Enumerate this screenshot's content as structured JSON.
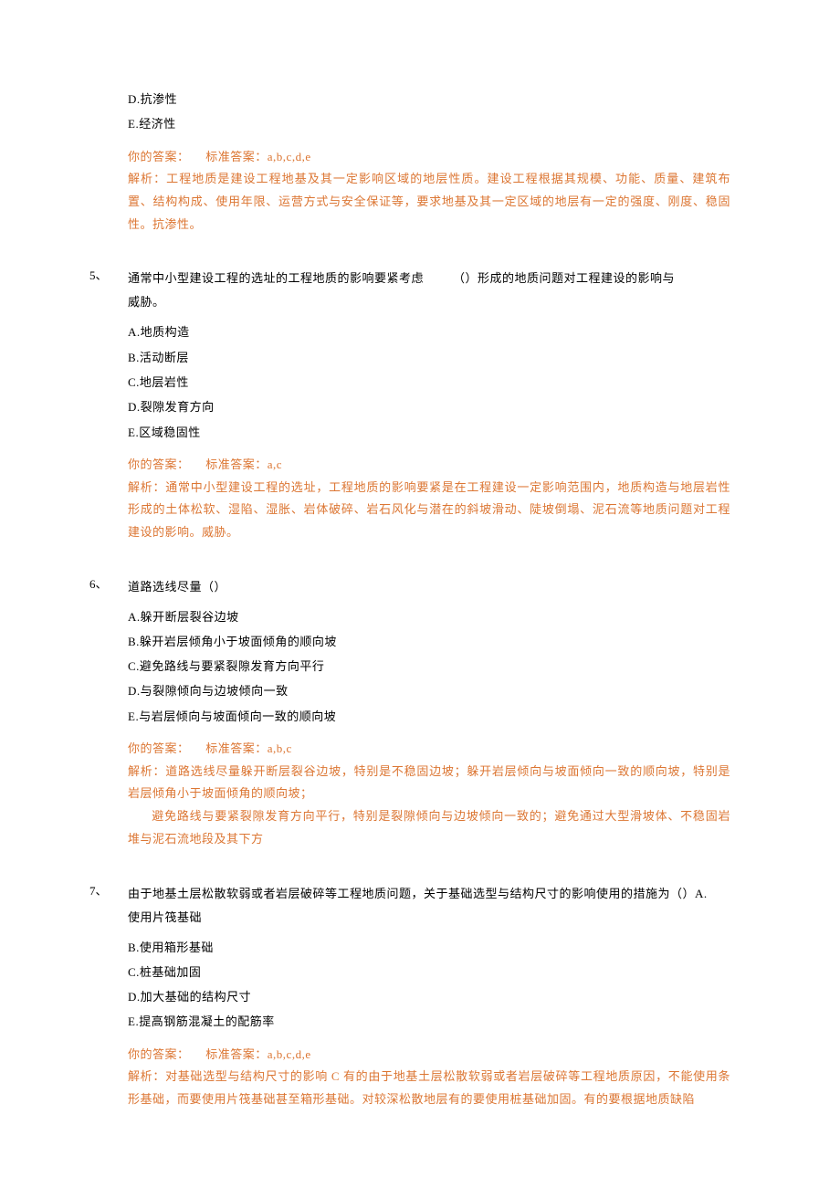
{
  "top": {
    "opt_d": "D.抗渗性",
    "opt_e": "E.经济性",
    "your_answer_label": "你的答案：",
    "std_answer_label": "标准答案：",
    "std_answer_value": "a,b,c,d,e",
    "expl_label": "解析：",
    "expl_text": "工程地质是建设工程地基及其一定影响区域的地层性质。建设工程根据其规模、功能、质量、建筑布置、结构构成、使用年限、运营方式与安全保证等，要求地基及其一定区域的地层有一定的强度、刚度、稳固性。抗渗性。"
  },
  "q5": {
    "num": "5、",
    "stem_a": "通常中小型建设工程的选址的工程地质的影响要紧考虑",
    "stem_b": "（）形成的地质问题对工程建设的影响与",
    "stem_c": "威胁。",
    "opt_a": "A.地质构造",
    "opt_b": "B.活动断层",
    "opt_c": "C.地层岩性",
    "opt_d": "D.裂隙发育方向",
    "opt_e": "E.区域稳固性",
    "your_answer_label": "你的答案：",
    "std_answer_label": "标准答案：",
    "std_answer_value": "a,c",
    "expl_label": "解析：",
    "expl_text": "通常中小型建设工程的选址，工程地质的影响要紧是在工程建设一定影响范围内，地质构造与地层岩性形成的土体松软、湿陷、湿胀、岩体破碎、岩石风化与潜在的斜坡滑动、陡坡倒塌、泥石流等地质问题对工程建设的影响。威胁。"
  },
  "q6": {
    "num": "6、",
    "stem": "道路选线尽量（）",
    "opt_a": "A.躲开断层裂谷边坡",
    "opt_b": "B.躲开岩层倾角小于坡面倾角的顺向坡",
    "opt_c": "C.避免路线与要紧裂隙发育方向平行",
    "opt_d": "D.与裂隙倾向与边坡倾向一致",
    "opt_e": "E.与岩层倾向与坡面倾向一致的顺向坡",
    "your_answer_label": "你的答案：",
    "std_answer_label": "标准答案：",
    "std_answer_value": "a,b,c",
    "expl_label": "解析：",
    "expl_text1": "道路选线尽量躲开断层裂谷边坡，特别是不稳固边坡；躲开岩层倾向与坡面倾向一致的顺向坡，特别是岩层倾角小于坡面倾角的顺向坡；",
    "expl_text2": "避免路线与要紧裂隙发育方向平行，特别是裂隙倾向与边坡倾向一致的；避免通过大型滑坡体、不稳固岩堆与泥石流地段及其下方"
  },
  "q7": {
    "num": "7、",
    "stem_a": "由于地基土层松散软弱或者岩层破碎等工程地质问题，关于基础选型与结构尺寸的影响使用的措施为（）A.",
    "stem_b": "使用片筏基础",
    "opt_b": "B.使用箱形基础",
    "opt_c": "C.桩基础加固",
    "opt_d": "D.加大基础的结构尺寸",
    "opt_e": "E.提高钢筋混凝土的配筋率",
    "your_answer_label": "你的答案：",
    "std_answer_label": "标准答案：",
    "std_answer_value": "a,b,c,d,e",
    "expl_label": "解析：",
    "expl_text": "对基础选型与结构尺寸的影响 C 有的由于地基土层松散软弱或者岩层破碎等工程地质原因，不能使用条形基础，而要使用片筏基础甚至箱形基础。对较深松散地层有的要使用桩基础加固。有的要根据地质缺陷"
  }
}
